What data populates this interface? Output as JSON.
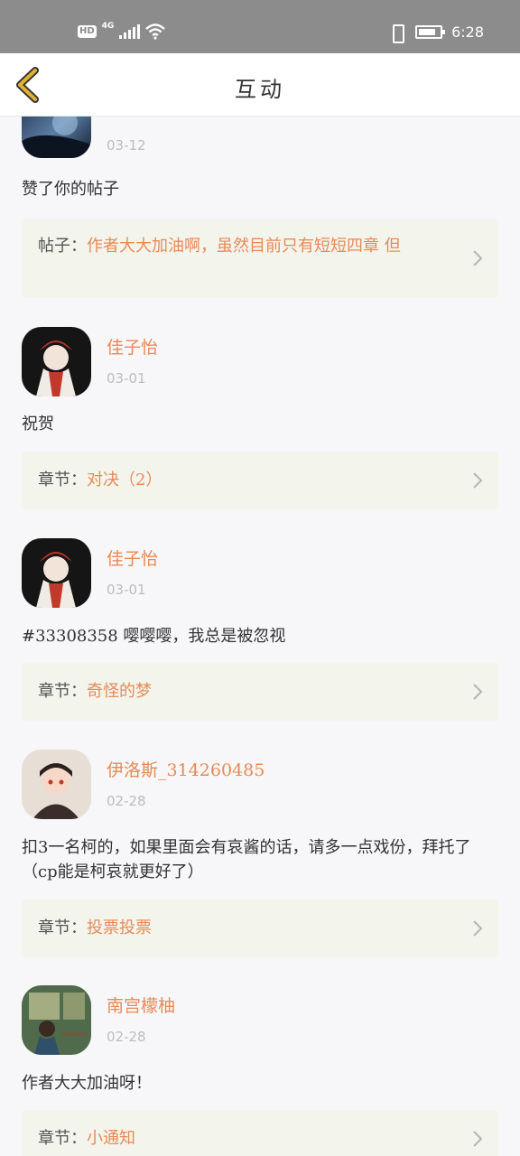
{
  "status": {
    "hd": "HD",
    "network": "4G",
    "time": "6:28"
  },
  "header": {
    "title": "互动",
    "back_icon": "chevron-left-icon",
    "accent": "#e0b030"
  },
  "colors": {
    "name": "#e88a55",
    "card_bg": "#f3f4ec"
  },
  "items": [
    {
      "name": "",
      "date": "03-12",
      "content": "赞了你的帖子",
      "ref_label": "帖子：",
      "ref_title": "作者大大加油啊，虽然目前只有短短四章 但"
    },
    {
      "name": "佳子怡",
      "date": "03-01",
      "content": "祝贺",
      "ref_label": "章节：",
      "ref_title": "对决（2）"
    },
    {
      "name": "佳子怡",
      "date": "03-01",
      "content": "#33308358 嘤嘤嘤，我总是被忽视",
      "ref_label": "章节：",
      "ref_title": "奇怪的梦"
    },
    {
      "name": "伊洛斯_314260485",
      "date": "02-28",
      "content": "扣3一名柯的，如果里面会有哀酱的话，请多一点戏份，拜托了（cp能是柯哀就更好了）",
      "ref_label": "章节：",
      "ref_title": "投票投票"
    },
    {
      "name": "南宫檬柚",
      "date": "02-28",
      "content": "作者大大加油呀！",
      "ref_label": "章节：",
      "ref_title": "小通知"
    }
  ]
}
